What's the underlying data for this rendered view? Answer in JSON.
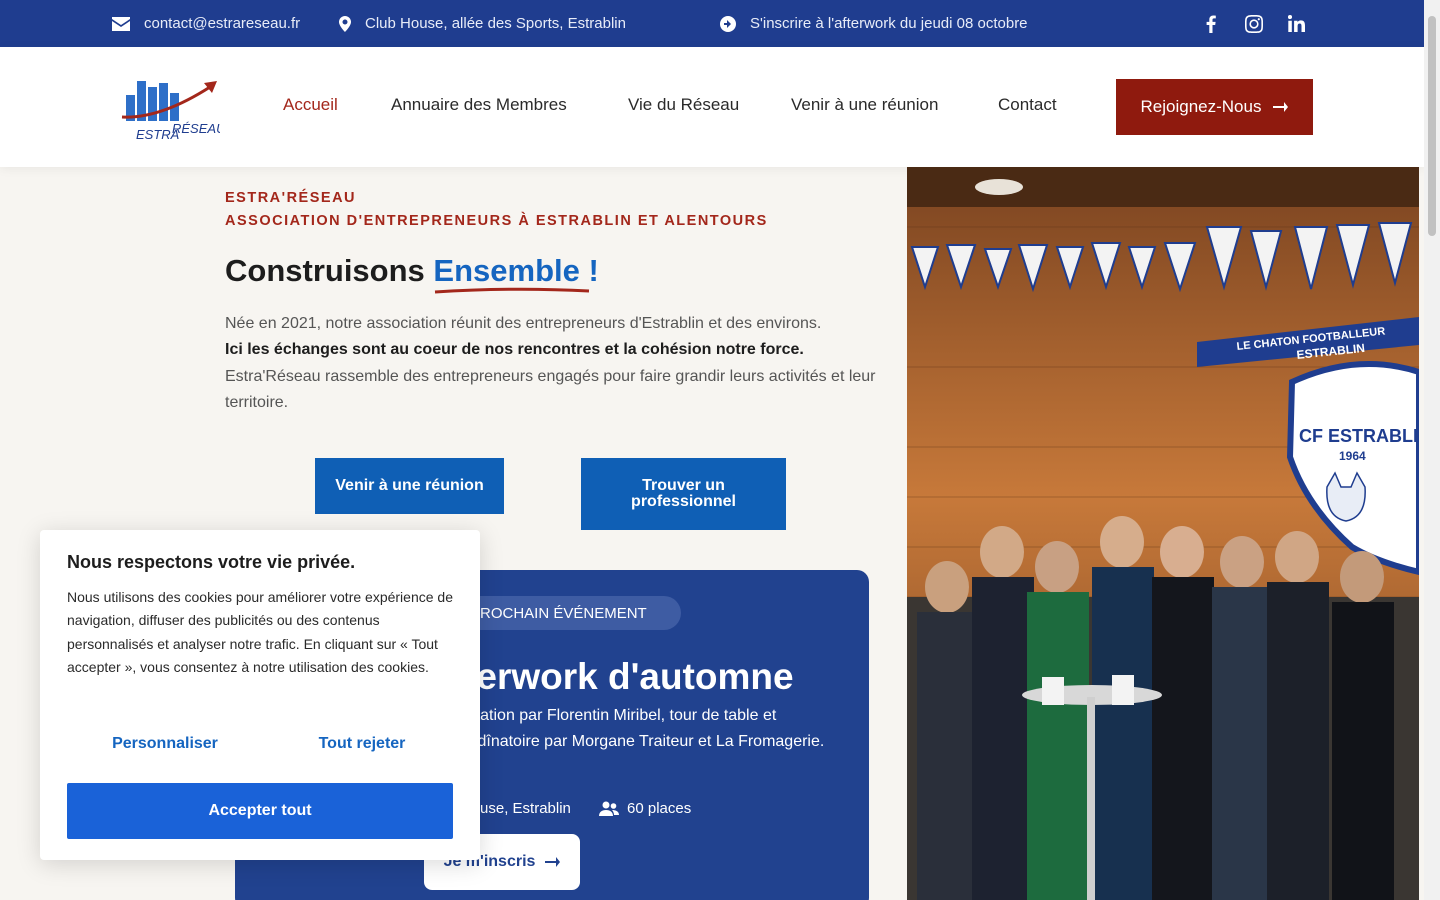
{
  "topbar": {
    "email": "contact@estrareseau.fr",
    "address": "Club House, allée des Sports, Estrablin",
    "announcement": "S'inscrire à l'afterwork du jeudi 08 octobre"
  },
  "header": {
    "logo_text_1": "ESTRA",
    "logo_text_2": "RÉSEAU",
    "nav": [
      {
        "label": "Accueil",
        "active": true
      },
      {
        "label": "Annuaire des Membres"
      },
      {
        "label": "Vie du Réseau"
      },
      {
        "label": "Venir à une réunion"
      },
      {
        "label": "Contact"
      }
    ],
    "cta_label": "Rejoignez-Nous"
  },
  "hero": {
    "eyebrow_1": "ESTRA'RÉSEAU",
    "eyebrow_2": "ASSOCIATION D'ENTREPRENEURS À ESTRABLIN ET ALENTOURS",
    "title_main": "Construisons ",
    "title_highlight": "Ensemble !",
    "para_1": "Née en 2021, notre association réunit des entrepreneurs d'Estrablin et des environs.",
    "para_2": "Ici les échanges sont au coeur de nos rencontres et la cohésion notre force.",
    "para_3": "Estra'Réseau rassemble des entrepreneurs engagés pour faire grandir leurs activités et leur territoire.",
    "btn_1": "Venir à une réunion",
    "btn_2": "Trouver un professionnel"
  },
  "event": {
    "chip": "PROCHAIN ÉVÉNEMENT",
    "title": "Afterwork d'automne",
    "desc": "Présentation par Florentin Miribel, tour de table et apéritif dînatoire par Morgane Traiteur et La Fromagerie.",
    "location": "Club-House, Estrablin",
    "places": "60 places",
    "register": "Je m'inscris"
  },
  "photo": {
    "club_name": "CF ESTRABLIN",
    "club_year": "1964",
    "scarf_text_1": "LE CHATON FOOTBALLEUR",
    "scarf_text_2": "ESTRABLIN"
  },
  "cookie": {
    "title": "Nous respectons votre vie privée.",
    "text": "Nous utilisons des cookies pour améliorer votre expérience de navigation, diffuser des publicités ou des contenus personnalisés et analyser notre trafic. En cliquant sur « Tout accepter », vous consentez à notre utilisation des cookies.",
    "customize": "Personnaliser",
    "reject": "Tout rejeter",
    "accept": "Accepter tout"
  },
  "colors": {
    "topbar": "#1f3d8f",
    "accent_red": "#8f1a0e",
    "blue_button": "#0f5fb5",
    "card": "#21428f"
  }
}
